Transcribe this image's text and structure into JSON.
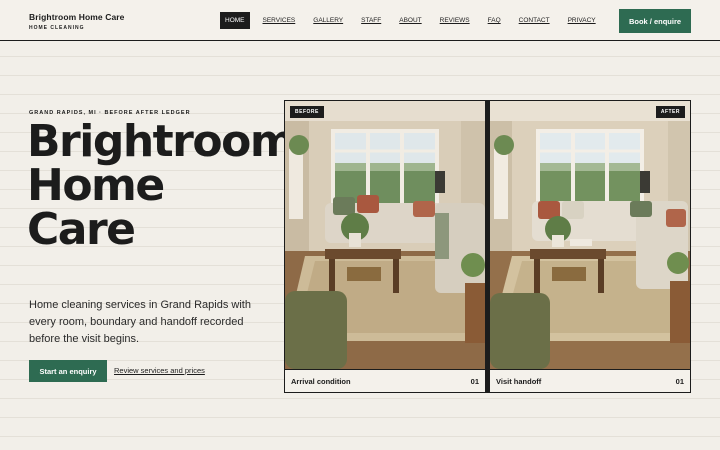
{
  "brand": {
    "name": "Brightroom Home Care",
    "tagline": "HOME CLEANING"
  },
  "nav": {
    "items": [
      {
        "label": "HOME",
        "active": true
      },
      {
        "label": "SERVICES",
        "active": false
      },
      {
        "label": "GALLERY",
        "active": false
      },
      {
        "label": "STAFF",
        "active": false
      },
      {
        "label": "ABOUT",
        "active": false
      },
      {
        "label": "REVIEWS",
        "active": false
      },
      {
        "label": "FAQ",
        "active": false
      },
      {
        "label": "CONTACT",
        "active": false
      },
      {
        "label": "PRIVACY",
        "active": false
      }
    ],
    "cta_label": "Book / enquire"
  },
  "hero": {
    "eyebrow": "GRAND RAPIDS, MI · BEFORE AFTER LEDGER",
    "title_lines": [
      "Brightroom",
      "Home",
      "Care"
    ],
    "description": "Home cleaning services in Grand Rapids with every room, boundary and handoff recorded before the visit begins.",
    "primary_button": "Start an enquiry",
    "secondary_link": "Review services and prices"
  },
  "comparison": {
    "before": {
      "tag": "BEFORE",
      "caption": "Arrival condition",
      "number": "01"
    },
    "after": {
      "tag": "AFTER",
      "caption": "Visit handoff",
      "number": "01"
    }
  },
  "colors": {
    "accent": "#2e6b52",
    "ink": "#1c1c1c",
    "background": "#f2efe9"
  }
}
